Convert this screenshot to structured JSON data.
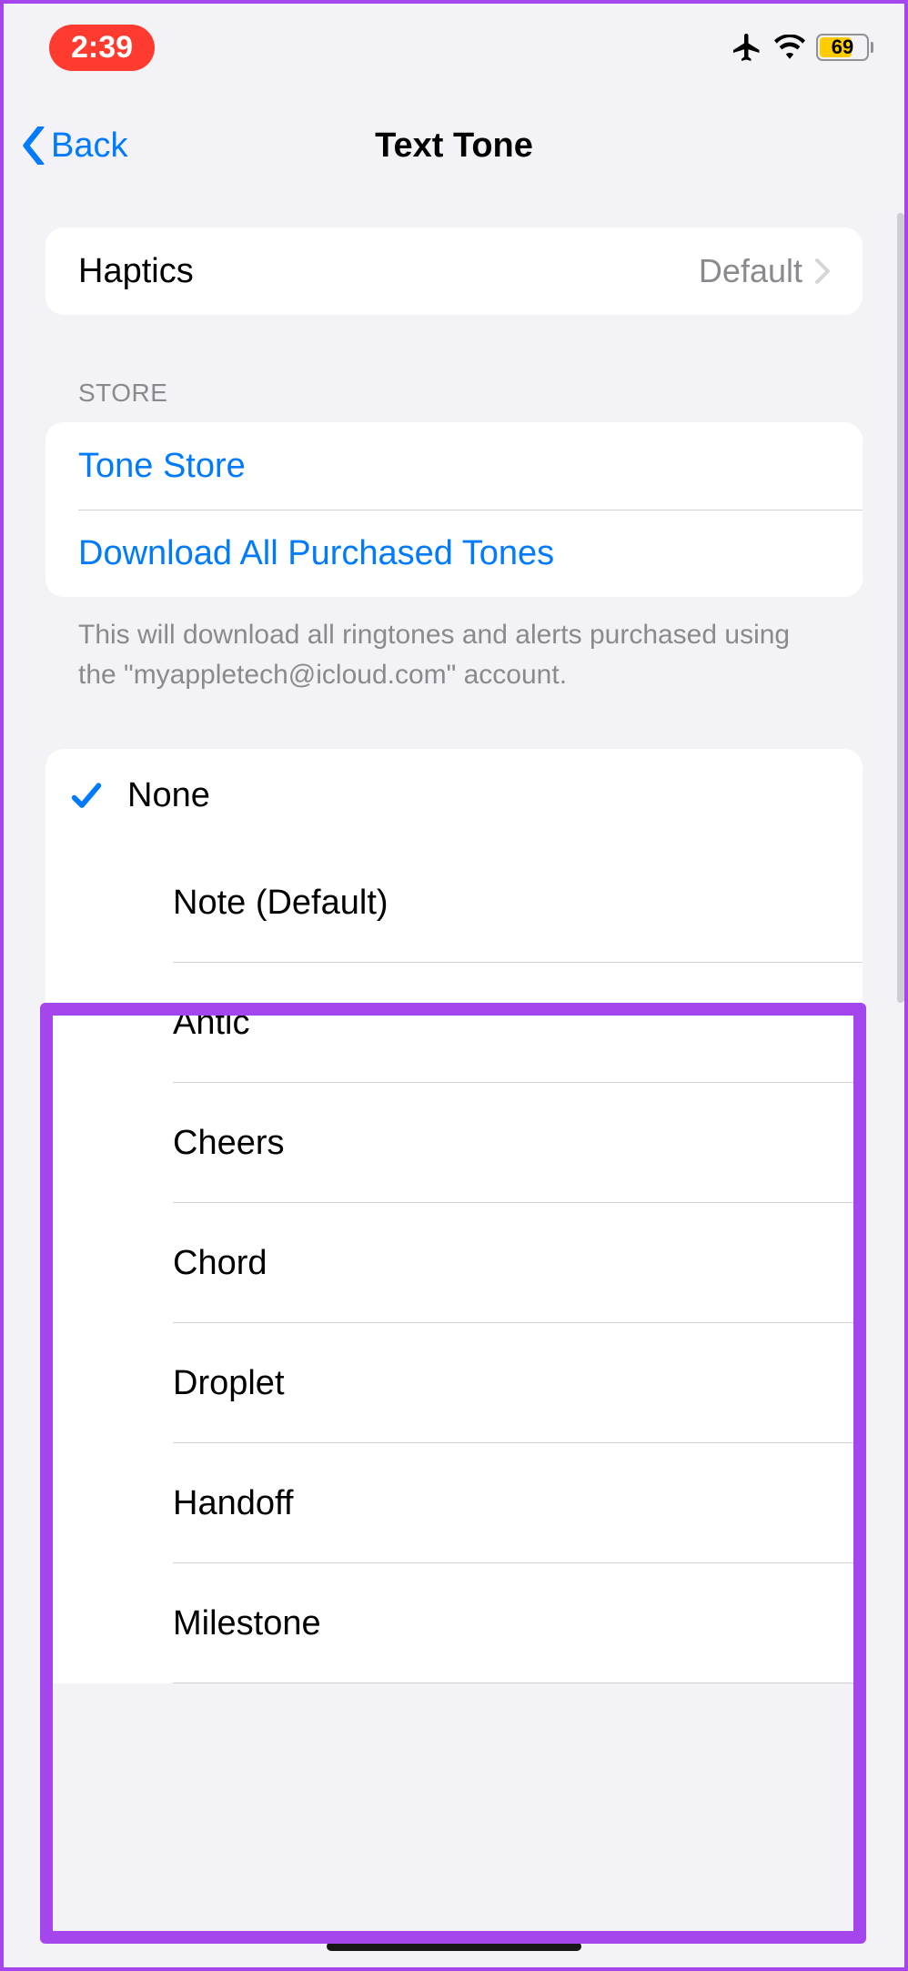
{
  "status": {
    "time": "2:39",
    "battery": "69"
  },
  "nav": {
    "back_label": "Back",
    "title": "Text Tone"
  },
  "haptics": {
    "label": "Haptics",
    "value": "Default"
  },
  "store": {
    "header": "STORE",
    "tone_store": "Tone Store",
    "download_all": "Download All Purchased Tones",
    "footer": "This will download all ringtones and alerts purchased using the \"myappletech@icloud.com\" account."
  },
  "tones": {
    "selected": "None",
    "list": [
      "Note (Default)",
      "Antic",
      "Cheers",
      "Chord",
      "Droplet",
      "Handoff",
      "Milestone"
    ]
  }
}
